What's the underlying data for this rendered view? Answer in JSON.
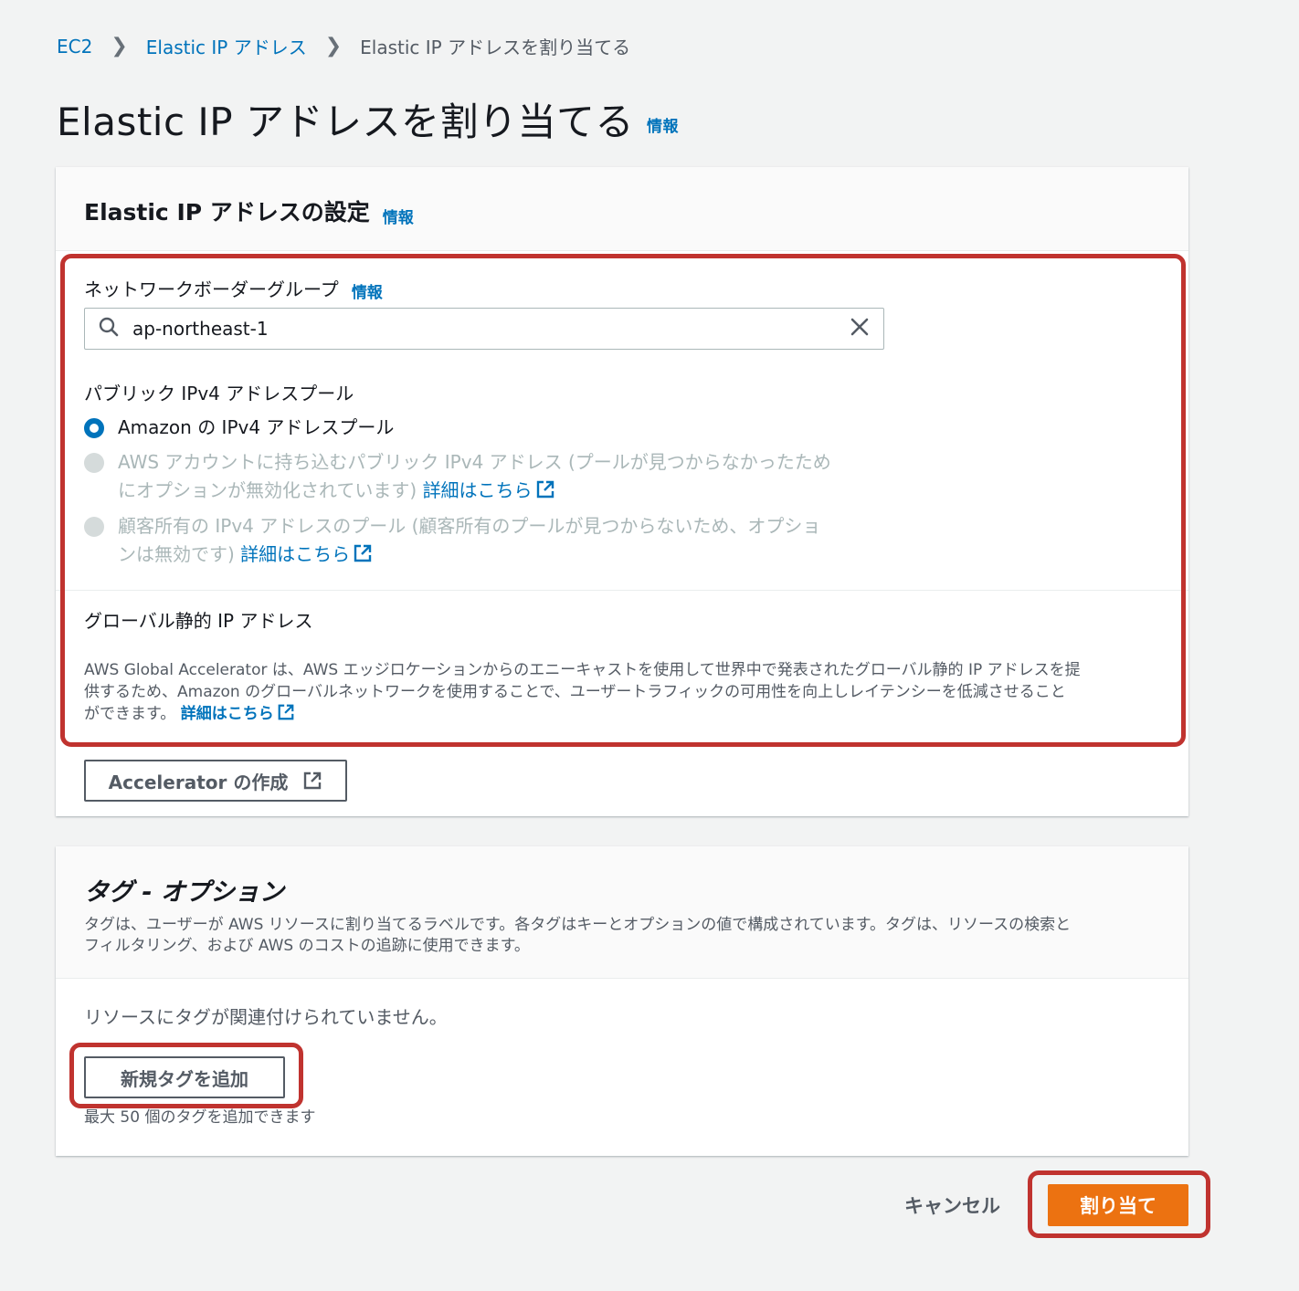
{
  "breadcrumb": {
    "items": [
      "EC2",
      "Elastic IP アドレス"
    ],
    "current": "Elastic IP アドレスを割り当てる"
  },
  "page": {
    "title": "Elastic IP アドレスを割り当てる",
    "info": "情報"
  },
  "settings": {
    "title": "Elastic IP アドレスの設定",
    "info": "情報",
    "network_border_group": {
      "label": "ネットワークボーダーグループ",
      "info": "情報",
      "value": "ap-northeast-1"
    },
    "ipv4_pool": {
      "label": "パブリック IPv4 アドレスプール",
      "options": [
        {
          "text": "Amazon の IPv4 アドレスプール",
          "selected": true,
          "disabled": false
        },
        {
          "line1": "AWS アカウントに持ち込むパブリック IPv4 アドレス (プールが見つからなかったため",
          "line2": "にオプションが無効化されています)",
          "link": "詳細はこちら",
          "selected": false,
          "disabled": true
        },
        {
          "line1": "顧客所有の IPv4 アドレスのプール (顧客所有のプールが見つからないため、オプショ",
          "line2": "ンは無効です)",
          "link": "詳細はこちら",
          "selected": false,
          "disabled": true
        }
      ]
    },
    "global_static": {
      "label": "グローバル静的 IP アドレス",
      "desc_line1": "AWS Global Accelerator は、AWS エッジロケーションからのエニーキャストを使用して世界中で発表されたグローバル静的 IP アドレスを提",
      "desc_line2": "供するため、Amazon のグローバルネットワークを使用することで、ユーザートラフィックの可用性を向上しレイテンシーを低減させること",
      "desc_line3": "ができます。",
      "link": "詳細はこちら"
    },
    "accelerator_button": "Accelerator の作成"
  },
  "tags": {
    "title": "タグ - オプション",
    "desc_line1": "タグは、ユーザーが AWS リソースに割り当てるラベルです。各タグはキーとオプションの値で構成されています。タグは、リソースの検索と",
    "desc_line2": "フィルタリング、および AWS のコストの追跡に使用できます。",
    "empty": "リソースにタグが関連付けられていません。",
    "add_button": "新規タグを追加",
    "limit": "最大 50 個のタグを追加できます"
  },
  "footer": {
    "cancel": "キャンセル",
    "submit": "割り当て"
  },
  "colors": {
    "link": "#0073bb",
    "primary": "#ec7211",
    "highlight": "#c0332f"
  }
}
